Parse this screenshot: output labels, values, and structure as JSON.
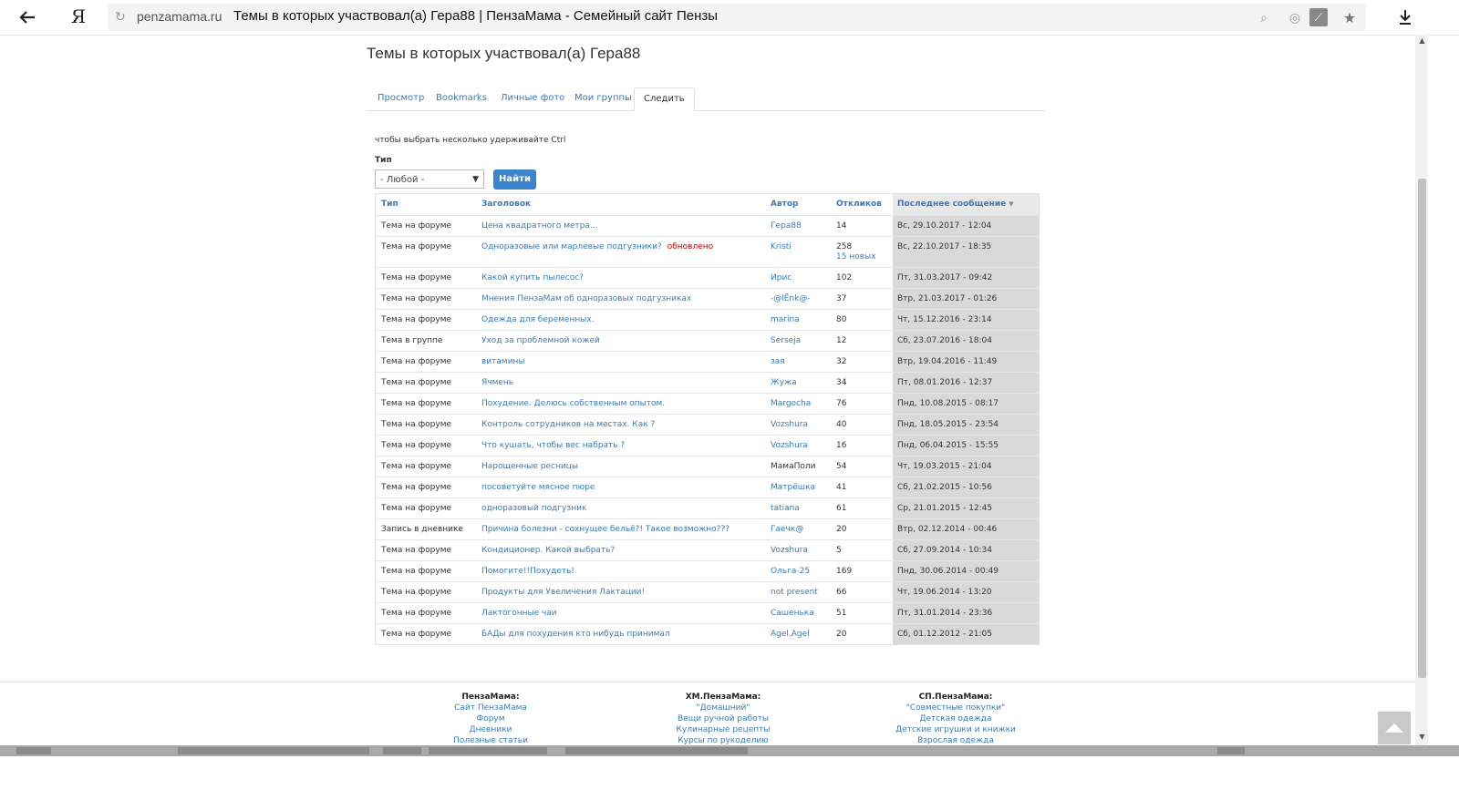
{
  "browser": {
    "domain": "penzamama.ru",
    "page_title": "Темы в которых участвовал(а) Гера88 | ПензаМама - Семейный сайт Пензы",
    "logo_letter": "Я"
  },
  "page": {
    "heading": "Темы в которых участвовал(а) Гера88",
    "tabs": [
      {
        "label": "Просмотр"
      },
      {
        "label": "Bookmarks"
      },
      {
        "label": "Личные фото"
      },
      {
        "label": "Мои группы"
      },
      {
        "label": "Следить",
        "active": true
      }
    ],
    "hint": "чтобы выбрать несколько удерживайте Ctrl",
    "filter": {
      "label": "Тип",
      "selected": "- Любой -",
      "button": "Найти"
    }
  },
  "table": {
    "headers": {
      "type": "Тип",
      "title": "Заголовок",
      "author": "Автор",
      "replies": "Откликов",
      "last": "Последнее сообщение"
    },
    "rows": [
      {
        "type": "Тема на форуме",
        "title": "Цена квадратного метра...",
        "author": "Гера88",
        "replies": "14",
        "last": "Вс, 29.10.2017 - 12:04"
      },
      {
        "type": "Тема на форуме",
        "title": "Одноразовые или марлевые подгузники?",
        "updated": "обновлено",
        "author": "Kristi",
        "replies": "258",
        "new": "15 новых",
        "last": "Вс, 22.10.2017 - 18:35"
      },
      {
        "type": "Тема на форуме",
        "title": "Какой купить пылесос?",
        "author": "Ирис",
        "replies": "102",
        "last": "Пт, 31.03.2017 - 09:42"
      },
      {
        "type": "Тема на форуме",
        "title": "Мнения ПензаМам об одноразовых подгузниках",
        "author": "-@lЁnk@-",
        "replies": "37",
        "last": "Втр, 21.03.2017 - 01:26"
      },
      {
        "type": "Тема на форуме",
        "title": "Одежда для беременных.",
        "author": "marina",
        "replies": "80",
        "last": "Чт, 15.12.2016 - 23:14"
      },
      {
        "type": "Тема в группе",
        "title": "Уход за проблемной кожей",
        "author": "Serseja",
        "replies": "12",
        "last": "Сб, 23.07.2016 - 18:04"
      },
      {
        "type": "Тема на форуме",
        "title": "витамины",
        "author": "зая",
        "replies": "32",
        "last": "Втр, 19.04.2016 - 11:49"
      },
      {
        "type": "Тема на форуме",
        "title": "Ячмень",
        "author": "Жужа",
        "replies": "34",
        "last": "Пт, 08.01.2016 - 12:37"
      },
      {
        "type": "Тема на форуме",
        "title": "Похудение. Делюсь собственным опытом.",
        "author": "Margocha",
        "replies": "76",
        "last": "Пнд, 10.08.2015 - 08:17"
      },
      {
        "type": "Тема на форуме",
        "title": "Контроль сотрудников на местах. Как ?",
        "author": "Vozshura",
        "replies": "40",
        "last": "Пнд, 18.05.2015 - 23:54"
      },
      {
        "type": "Тема на форуме",
        "title": "Что кушать, чтобы вес набрать ?",
        "author": "Vozshura",
        "replies": "16",
        "last": "Пнд, 06.04.2015 - 15:55"
      },
      {
        "type": "Тема на форуме",
        "title": "Нарощенные ресницы",
        "author": "МамаПоли",
        "author_plain": true,
        "replies": "54",
        "last": "Чт, 19.03.2015 - 21:04"
      },
      {
        "type": "Тема на форуме",
        "title": "посоветуйте мясное пюре",
        "author": "Матрёшка",
        "replies": "41",
        "last": "Сб, 21.02.2015 - 10:56"
      },
      {
        "type": "Тема на форуме",
        "title": "одноразовый подгузник",
        "author": "tatiana",
        "replies": "61",
        "last": "Ср, 21.01.2015 - 12:45"
      },
      {
        "type": "Запись в дневнике",
        "title": "Причина болезни - сохнущее бельё?! Такое возможно???",
        "author": "Гаечк@",
        "replies": "20",
        "last": "Втр, 02.12.2014 - 00:46"
      },
      {
        "type": "Тема на форуме",
        "title": "Кондиционер. Какой выбрать?",
        "author": "Vozshura",
        "replies": "5",
        "last": "Сб, 27.09.2014 - 10:34"
      },
      {
        "type": "Тема на форуме",
        "title": "Помогите!!Похудеть!",
        "author": "Ольга-25",
        "replies": "169",
        "last": "Пнд, 30.06.2014 - 00:49"
      },
      {
        "type": "Тема на форуме",
        "title": "Продукты для Увеличения Лактации!",
        "author": "not present",
        "replies": "66",
        "last": "Чт, 19.06.2014 - 13:20"
      },
      {
        "type": "Тема на форуме",
        "title": "Лактогонные чаи",
        "author": "Сашенька",
        "replies": "51",
        "last": "Пт, 31.01.2014 - 23:36"
      },
      {
        "type": "Тема на форуме",
        "title": "БАДы для похудения кто нибудь принимал",
        "author": "Agel.Agel",
        "replies": "20",
        "last": "Сб, 01.12.2012 - 21:05"
      }
    ]
  },
  "footer": {
    "columns": [
      {
        "title": "ПензаМама:",
        "links": [
          "Сайт ПензаМама",
          "Форум",
          "Дневники",
          "Полезные статьи"
        ]
      },
      {
        "title": "ХМ.ПензаМама:",
        "links": [
          "\"Домашний\"",
          "Вещи ручной работы",
          "Кулинарные рецепты",
          "Курсы по рукоделию"
        ]
      },
      {
        "title": "СП.ПензаМама:",
        "links": [
          "\"Совместные покупки\"",
          "Детская одежда",
          "Детские игрушки и книжки",
          "Взрослая одежда"
        ]
      }
    ]
  },
  "icons": {
    "back": "arrow-left-icon",
    "reload": "reload-icon",
    "search": "search-icon",
    "protect": "protect-icon",
    "clean": "broom-icon",
    "bookmark": "star-icon",
    "download": "download-icon",
    "to_top": "arrow-up-icon"
  },
  "colors": {
    "link": "#3a7ab8",
    "button": "#3a86cc",
    "updated": "#cc0000",
    "last_col_bg": "#d9d9d9"
  }
}
